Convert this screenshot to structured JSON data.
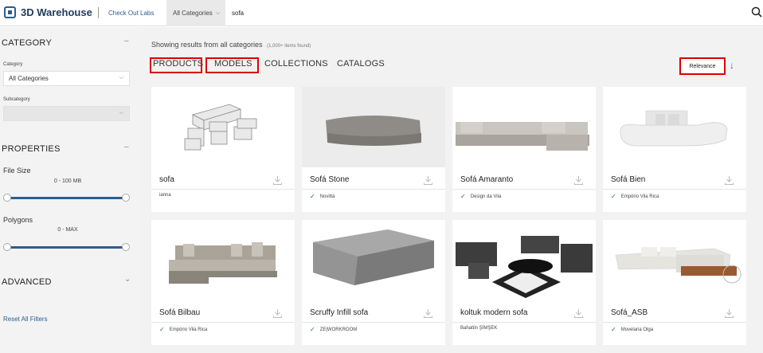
{
  "header": {
    "app_name": "3D Warehouse",
    "labs_link": "Check Out Labs",
    "category_select": "All Categories",
    "search_value": "sofa"
  },
  "sidebar": {
    "category_title": "CATEGORY",
    "category_label": "Category",
    "category_value": "All Categories",
    "subcategory_label": "Subcategory",
    "subcategory_value": "",
    "properties_title": "PROPERTIES",
    "file_size_label": "File Size",
    "file_size_range": "0 - 100 MB",
    "polygons_label": "Polygons",
    "polygons_range": "0 - MAX",
    "advanced_title": "ADVANCED",
    "reset_label": "Reset All Filters",
    "collapse_symbol": "–",
    "expand_symbol": "⌄"
  },
  "main": {
    "results_text": "Showing results from all categories",
    "results_count": "(1,000+ items found)",
    "tabs": [
      {
        "label": "PRODUCTS"
      },
      {
        "label": "MODELS"
      },
      {
        "label": "COLLECTIONS"
      },
      {
        "label": "CATALOGS"
      }
    ],
    "sort_label": "Relevance",
    "sort_arrow": "↓"
  },
  "cards": [
    {
      "title": "sofa",
      "author": "ianna",
      "verified": false
    },
    {
      "title": "Sofá Stone",
      "author": "Novittá",
      "verified": true
    },
    {
      "title": "Sofá Amaranto",
      "author": "Design da Vila",
      "verified": true
    },
    {
      "title": "Sofá Bien",
      "author": "Empório Vila Rica",
      "verified": true
    },
    {
      "title": "Sofá Bilbau",
      "author": "Empório Vila Rica",
      "verified": true
    },
    {
      "title": "Scruffy Infill sofa",
      "author": "ZE|WORKROOM",
      "verified": true
    },
    {
      "title": "koltuk modern sofa",
      "author": "Bahattin ŞİMŞEK",
      "verified": false
    },
    {
      "title": "Sofá_ASB",
      "author": "Movelaria Olga",
      "verified": true
    }
  ],
  "colors": {
    "brand": "#2b5d8f",
    "highlight": "#dd0000"
  }
}
